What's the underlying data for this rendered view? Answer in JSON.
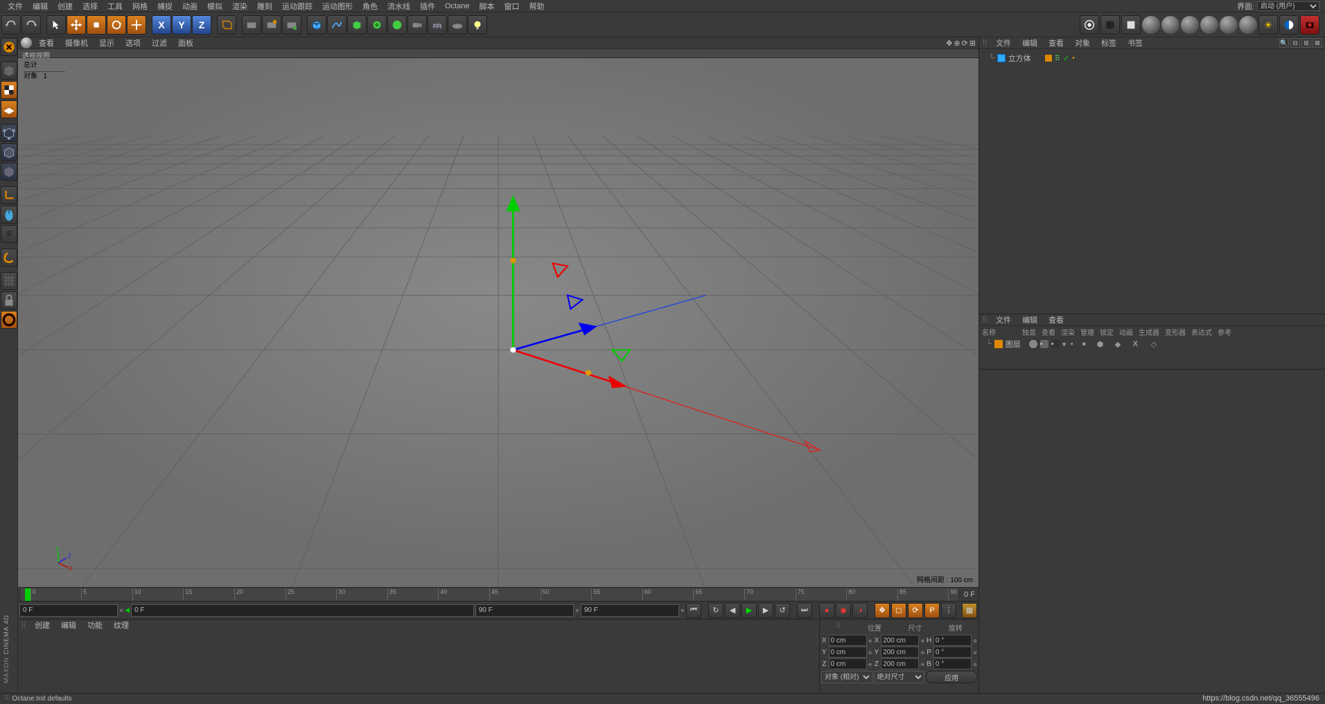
{
  "layout": {
    "label": "界面:",
    "value": "启动 (用户)"
  },
  "menubar": [
    "文件",
    "编辑",
    "创建",
    "选择",
    "工具",
    "网格",
    "捕捉",
    "动画",
    "模拟",
    "渲染",
    "雕刻",
    "运动跟踪",
    "运动图形",
    "角色",
    "流水线",
    "插件",
    "Octane",
    "脚本",
    "窗口",
    "帮助"
  ],
  "viewmenu": [
    "查看",
    "摄像机",
    "显示",
    "选项",
    "过滤",
    "面板"
  ],
  "viewport": {
    "title": "透视视图",
    "stats_total": "总计",
    "stats_objects_label": "对象",
    "stats_objects_count": "1",
    "grid_label": "网格间距 : ",
    "grid_value": "100 cm"
  },
  "timeline": {
    "ticks": [
      "0",
      "5",
      "10",
      "15",
      "20",
      "25",
      "30",
      "35",
      "40",
      "45",
      "50",
      "55",
      "60",
      "65",
      "70",
      "75",
      "80",
      "85",
      "90"
    ],
    "end_label": "0 F",
    "start_field": "0 F",
    "range_start": "0 F",
    "range_end": "90 F",
    "end_field": "90 F"
  },
  "materials": {
    "menu": [
      "创建",
      "编辑",
      "功能",
      "纹理"
    ]
  },
  "coords": {
    "headers": [
      "位置",
      "尺寸",
      "旋转"
    ],
    "rows": [
      {
        "axis": "X",
        "pos": "0 cm",
        "size": "200 cm",
        "sz": "X",
        "rot": "0 °",
        "rl": "H"
      },
      {
        "axis": "Y",
        "pos": "0 cm",
        "size": "200 cm",
        "sz": "Y",
        "rot": "0 °",
        "rl": "P"
      },
      {
        "axis": "Z",
        "pos": "0 cm",
        "size": "200 cm",
        "sz": "Z",
        "rot": "0 °",
        "rl": "B"
      }
    ],
    "mode_obj": "对象 (相对)",
    "mode_size": "绝对尺寸",
    "apply": "应用"
  },
  "obj_mgr": {
    "menu": [
      "文件",
      "编辑",
      "查看",
      "对象",
      "标签",
      "书签"
    ],
    "cube": "立方体"
  },
  "layer_mgr": {
    "menu": [
      "文件",
      "编辑",
      "查看"
    ],
    "cols": [
      "名称",
      "独显",
      "查看",
      "渲染",
      "管理",
      "锁定",
      "动画",
      "生成器",
      "变形器",
      "表达式",
      "参考"
    ],
    "layer": "图层"
  },
  "status": "Octane:Init defaults",
  "watermark": "https://blog.csdn.net/qq_36555496",
  "brand1": "MAXON",
  "brand2": "CINEMA 4D"
}
